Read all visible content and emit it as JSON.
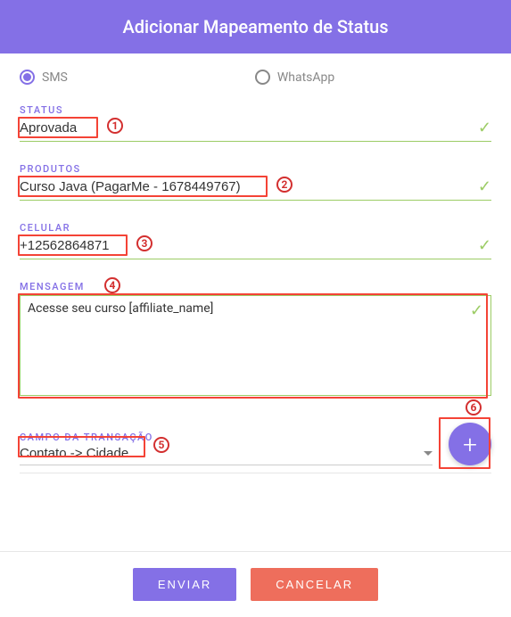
{
  "header": {
    "title": "Adicionar Mapeamento de Status"
  },
  "radios": {
    "sms_label": "SMS",
    "whatsapp_label": "WhatsApp"
  },
  "fields": {
    "status": {
      "label": "STATUS",
      "value": "Aprovada"
    },
    "produtos": {
      "label": "PRODUTOS",
      "value": "Curso Java (PagarMe - 1678449767)"
    },
    "celular": {
      "label": "CELULAR",
      "value": "+12562864871"
    },
    "mensagem": {
      "label": "MENSAGEM",
      "value": "Acesse seu curso [affiliate_name]"
    },
    "campo_transacao": {
      "label": "CAMPO DA TRANSAÇÃO",
      "value": "Contato -> Cidade"
    }
  },
  "annotations": {
    "a1": "1",
    "a2": "2",
    "a3": "3",
    "a4": "4",
    "a5": "5",
    "a6": "6"
  },
  "footer": {
    "submit": "ENVIAR",
    "cancel": "CANCELAR"
  }
}
